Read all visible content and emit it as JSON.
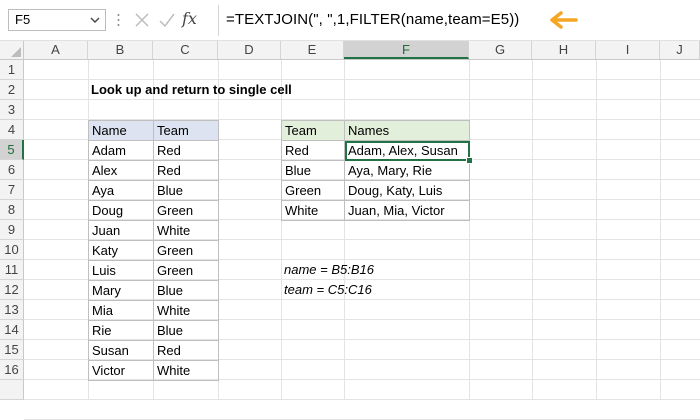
{
  "formula_bar": {
    "name_box": "F5",
    "fx_label": "fx",
    "formula": "=TEXTJOIN(\", \",1,FILTER(name,team=E5))"
  },
  "columns": [
    "A",
    "B",
    "C",
    "D",
    "E",
    "F",
    "G",
    "H",
    "I",
    "J"
  ],
  "rows": [
    "1",
    "2",
    "3",
    "4",
    "5",
    "6",
    "7",
    "8",
    "9",
    "10",
    "11",
    "12",
    "13",
    "14",
    "15",
    "16"
  ],
  "title": "Look up and return to single cell",
  "data_table": {
    "headers": [
      "Name",
      "Team"
    ],
    "rows": [
      [
        "Adam",
        "Red"
      ],
      [
        "Alex",
        "Red"
      ],
      [
        "Aya",
        "Blue"
      ],
      [
        "Doug",
        "Green"
      ],
      [
        "Juan",
        "White"
      ],
      [
        "Katy",
        "Green"
      ],
      [
        "Luis",
        "Green"
      ],
      [
        "Mary",
        "Blue"
      ],
      [
        "Mia",
        "White"
      ],
      [
        "Rie",
        "Blue"
      ],
      [
        "Susan",
        "Red"
      ],
      [
        "Victor",
        "White"
      ]
    ]
  },
  "result_table": {
    "headers": [
      "Team",
      "Names"
    ],
    "rows": [
      [
        "Red",
        "Adam, Alex, Susan"
      ],
      [
        "Blue",
        "Aya, Mary, Rie"
      ],
      [
        "Green",
        "Doug, Katy, Luis"
      ],
      [
        "White",
        "Juan, Mia, Victor"
      ]
    ]
  },
  "notes": {
    "name_def": "name = B5:B16",
    "team_def": "team = C5:C16"
  },
  "colors": {
    "excel_green": "#217346",
    "arrow_orange": "#f5a623",
    "header_blue": "#dde3f1",
    "header_green": "#e2efda"
  },
  "icons": [
    "chevron-down-icon",
    "cancel-x-icon",
    "enter-check-icon",
    "fx-icon",
    "arrow-left-icon"
  ]
}
